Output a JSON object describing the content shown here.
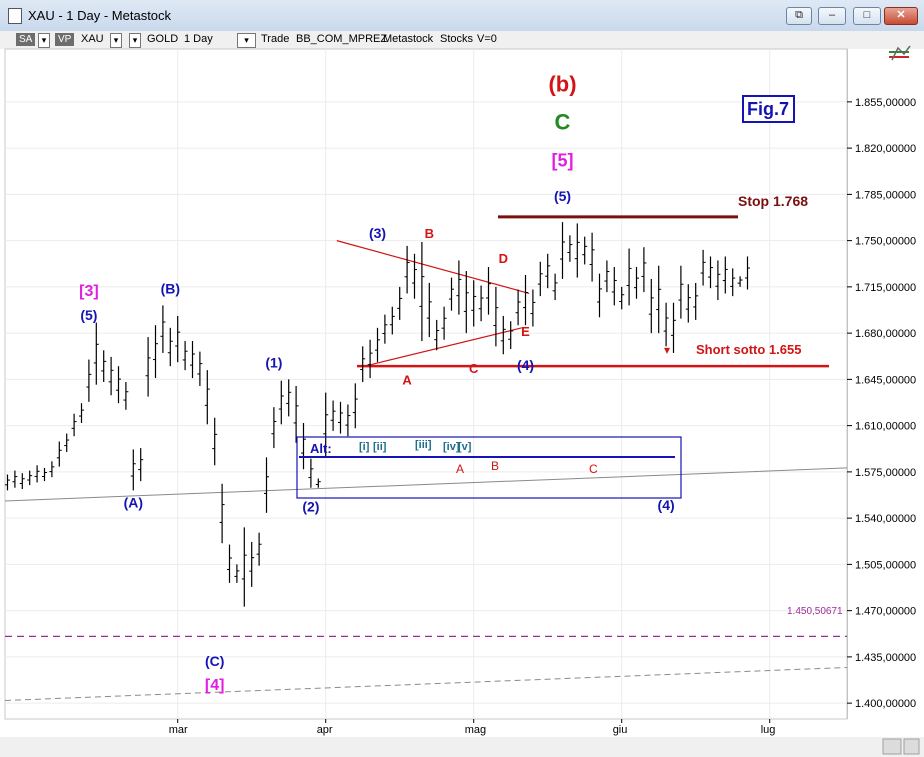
{
  "window": {
    "title": "XAU - 1 Day - Metastock",
    "buttons": {
      "restore_glyph": "⧉",
      "minimize_glyph": "–",
      "maximize_glyph": "□",
      "close_glyph": "✕"
    }
  },
  "toolbar": {
    "sa": "SA",
    "vp": "VP",
    "symbol": "XAU",
    "name": "GOLD",
    "period": "1 Day",
    "trade": "Trade",
    "layout": "BB_COM_MPREZ",
    "source": "Metastock",
    "group": "Stocks",
    "volume": "V=0",
    "dropdown_glyph": "▾"
  },
  "colors": {
    "blue": "#1414b4",
    "red": "#d21414",
    "green": "#1e8c1e",
    "magenta": "#e11ee1",
    "darkred": "#7a0f0f",
    "teal": "#1e6e8c",
    "bar": "#000000",
    "purple": "#9b2d9b"
  },
  "chart_data": {
    "type": "ohlc",
    "y_range": [
      1388,
      1895
    ],
    "y_ticks": [
      {
        "value": 1855,
        "label": "1.855,00000"
      },
      {
        "value": 1820,
        "label": "1.820,00000"
      },
      {
        "value": 1785,
        "label": "1.785,00000"
      },
      {
        "value": 1750,
        "label": "1.750,00000"
      },
      {
        "value": 1715,
        "label": "1.715,00000"
      },
      {
        "value": 1680,
        "label": "1.680,00000"
      },
      {
        "value": 1645,
        "label": "1.645,00000"
      },
      {
        "value": 1610,
        "label": "1.610,00000"
      },
      {
        "value": 1575,
        "label": "1.575,00000"
      },
      {
        "value": 1540,
        "label": "1.540,00000"
      },
      {
        "value": 1505,
        "label": "1.505,00000"
      },
      {
        "value": 1470,
        "label": "1.470,00000"
      },
      {
        "value": 1435,
        "label": "1.435,00000"
      },
      {
        "value": 1400,
        "label": "1.400,00000"
      }
    ],
    "x_ticks": [
      {
        "bar": 23,
        "label": "mar"
      },
      {
        "bar": 43,
        "label": "apr"
      },
      {
        "bar": 63,
        "label": "mag"
      },
      {
        "bar": 83,
        "label": "giu"
      },
      {
        "bar": 103,
        "label": "lug"
      }
    ],
    "highs": [
      1573,
      1576,
      1574,
      1576,
      1580,
      1578,
      1583,
      1598,
      1604,
      1619,
      1627,
      1660,
      1688,
      1667,
      1662,
      1655,
      1643,
      1592,
      1593,
      1677,
      1686,
      1701,
      1684,
      1693,
      1674,
      1674,
      1666,
      1652,
      1616,
      1566,
      1520,
      1505,
      1533,
      1522,
      1529,
      1586,
      1624,
      1644,
      1645,
      1640,
      1612,
      1585,
      1570,
      1635,
      1629,
      1628,
      1626,
      1642,
      1670,
      1675,
      1684,
      1694,
      1700,
      1715,
      1746,
      1740,
      1749,
      1718,
      1690,
      1700,
      1722,
      1735,
      1727,
      1720,
      1716,
      1730,
      1715,
      1693,
      1689,
      1713,
      1724,
      1713,
      1734,
      1740,
      1725,
      1764,
      1754,
      1763,
      1753,
      1756,
      1725,
      1735,
      1730,
      1715,
      1744,
      1730,
      1745,
      1721,
      1731,
      1703,
      1703,
      1731,
      1717,
      1718,
      1743,
      1738,
      1735,
      1738,
      1729,
      1723,
      1738
    ],
    "lows": [
      1561,
      1563,
      1562,
      1565,
      1567,
      1568,
      1571,
      1579,
      1590,
      1602,
      1612,
      1628,
      1641,
      1643,
      1633,
      1627,
      1622,
      1561,
      1568,
      1632,
      1646,
      1665,
      1655,
      1658,
      1652,
      1646,
      1640,
      1611,
      1580,
      1521,
      1491,
      1491,
      1473,
      1488,
      1504,
      1544,
      1593,
      1611,
      1617,
      1597,
      1577,
      1563,
      1563,
      1587,
      1606,
      1604,
      1602,
      1608,
      1643,
      1646,
      1658,
      1672,
      1679,
      1690,
      1710,
      1706,
      1674,
      1677,
      1667,
      1675,
      1697,
      1694,
      1680,
      1685,
      1689,
      1694,
      1670,
      1664,
      1668,
      1686,
      1686,
      1685,
      1708,
      1714,
      1705,
      1721,
      1734,
      1722,
      1732,
      1719,
      1692,
      1711,
      1701,
      1698,
      1701,
      1706,
      1711,
      1680,
      1680,
      1670,
      1665,
      1691,
      1688,
      1690,
      1716,
      1714,
      1705,
      1710,
      1708,
      1715,
      1713
    ],
    "annotations": [
      {
        "text": "[3]",
        "bar": 11,
        "y": 1708,
        "color": "magenta",
        "size": 16
      },
      {
        "text": "(5)",
        "bar": 11,
        "y": 1690,
        "color": "blue",
        "size": 14
      },
      {
        "text": "(A)",
        "bar": 17,
        "y": 1548,
        "color": "blue",
        "size": 14
      },
      {
        "text": "(B)",
        "bar": 22,
        "y": 1710,
        "color": "blue",
        "size": 14
      },
      {
        "text": "(C)",
        "bar": 28,
        "y": 1428,
        "color": "blue",
        "size": 14
      },
      {
        "text": "[4]",
        "bar": 28,
        "y": 1410,
        "color": "magenta",
        "size": 16
      },
      {
        "text": "(1)",
        "bar": 36,
        "y": 1654,
        "color": "blue",
        "size": 14
      },
      {
        "text": "(2)",
        "bar": 41,
        "y": 1545,
        "color": "blue",
        "size": 14
      },
      {
        "text": "(3)",
        "bar": 50,
        "y": 1752,
        "color": "blue",
        "size": 14
      },
      {
        "text": "B",
        "bar": 57,
        "y": 1752,
        "color": "red",
        "size": 13
      },
      {
        "text": "A",
        "bar": 54,
        "y": 1641,
        "color": "red",
        "size": 13
      },
      {
        "text": "C",
        "bar": 63,
        "y": 1650,
        "color": "red",
        "size": 13
      },
      {
        "text": "D",
        "bar": 67,
        "y": 1733,
        "color": "red",
        "size": 13
      },
      {
        "text": "E",
        "bar": 70,
        "y": 1678,
        "color": "red",
        "size": 13
      },
      {
        "text": "(4)",
        "bar": 70,
        "y": 1652,
        "color": "blue",
        "size": 14
      },
      {
        "text": "(b)",
        "bar": 75,
        "y": 1863,
        "color": "red",
        "size": 22
      },
      {
        "text": "C",
        "bar": 75,
        "y": 1834,
        "color": "green",
        "size": 22
      },
      {
        "text": "[5]",
        "bar": 75,
        "y": 1806,
        "color": "magenta",
        "size": 18
      },
      {
        "text": "(5)",
        "bar": 75,
        "y": 1780,
        "color": "blue",
        "size": 14
      },
      {
        "text": "(4)",
        "bar": 89,
        "y": 1546,
        "color": "blue",
        "size": 14
      }
    ],
    "lines": {
      "stop_label": "Stop 1.768",
      "stop_value": 1768,
      "short_label": "Short sotto 1.655",
      "short_value": 1655,
      "dashed_label": "1.450,50671",
      "dashed_value": 1450.5
    },
    "alt_box": {
      "title": "Alt:",
      "labels": [
        "[i]",
        "[ii]",
        "[iii]",
        "[iv]",
        "[v]",
        "A",
        "B",
        "C",
        "(4)"
      ]
    },
    "figure_label": "Fig.7"
  }
}
